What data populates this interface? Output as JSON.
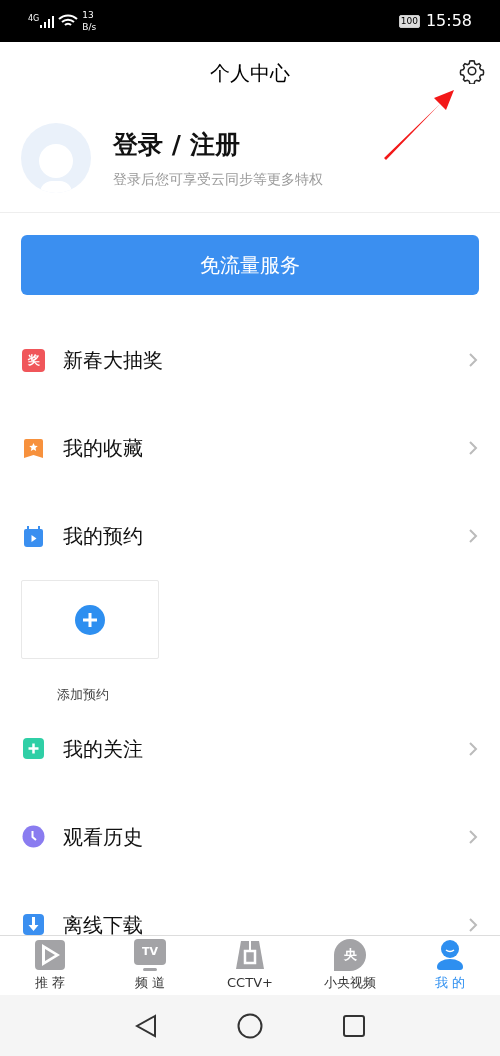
{
  "status_bar": {
    "network": "4G",
    "speed_value": "13",
    "speed_unit": "B/s",
    "battery": "100",
    "time": "15:58"
  },
  "header": {
    "title": "个人中心"
  },
  "profile": {
    "name": "登录 / 注册",
    "subtitle": "登录后您可享受云同步等更多特权"
  },
  "primary_button": {
    "label": "免流量服务"
  },
  "menu": [
    {
      "kind": "prize",
      "label": "新春大抽奖",
      "icon_text": "奖",
      "color": "#f0565a"
    },
    {
      "kind": "star",
      "label": "我的收藏",
      "color": "#f7913d"
    },
    {
      "kind": "calendar",
      "label": "我的预约",
      "color": "#3a8ff0"
    },
    {
      "kind": "add_card",
      "label": "添加预约"
    },
    {
      "kind": "plus",
      "label": "我的关注",
      "color": "#2fcfa6"
    },
    {
      "kind": "clock",
      "label": "观看历史",
      "color": "#8a7cf0"
    },
    {
      "kind": "download",
      "label": "离线下载",
      "color": "#3a8ff0"
    }
  ],
  "tabs": [
    {
      "label": "推 荐",
      "kind": "play",
      "selected": false
    },
    {
      "label": "频 道",
      "kind": "tv",
      "icon_text": "TV",
      "selected": false
    },
    {
      "label": "CCTV+",
      "kind": "bag",
      "selected": false
    },
    {
      "label": "小央视频",
      "kind": "bubble",
      "icon_text": "央",
      "selected": false
    },
    {
      "label": "我 的",
      "kind": "person",
      "selected": true
    }
  ]
}
